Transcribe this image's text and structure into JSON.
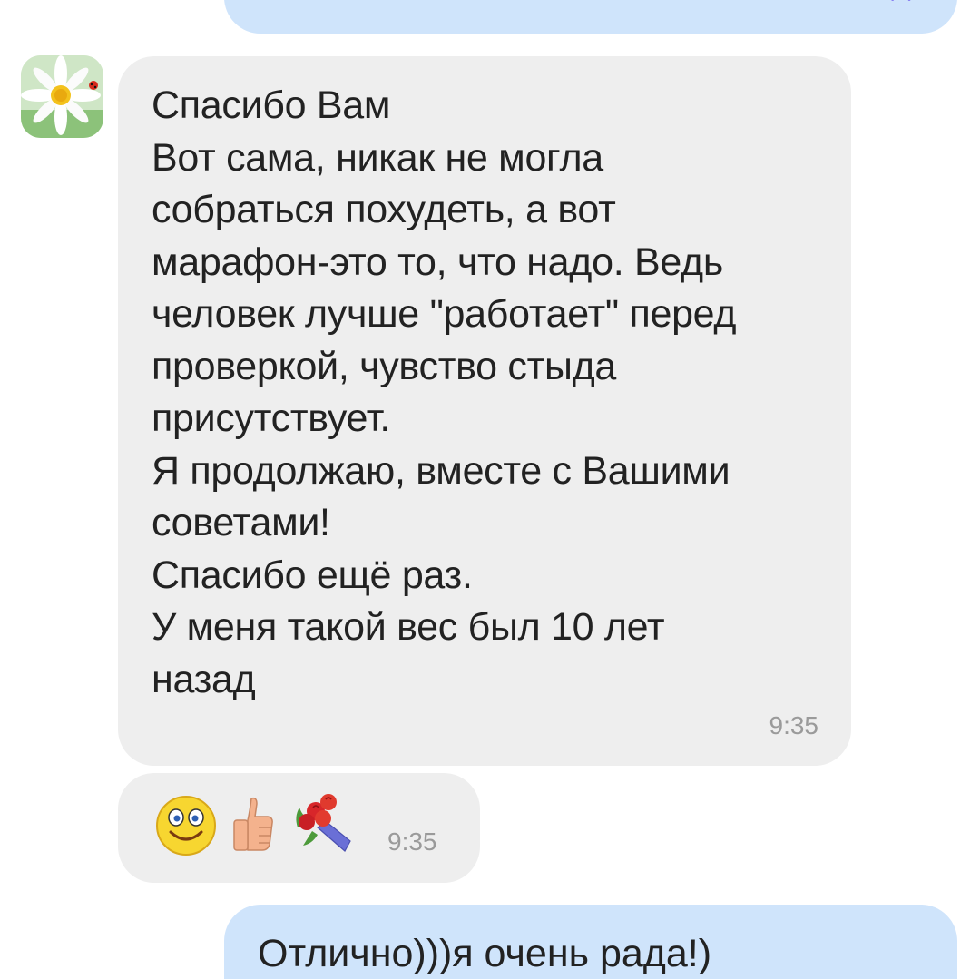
{
  "chat": {
    "messages": [
      {
        "direction": "incoming",
        "lines": [
          "Спасибо Вам",
          "Вот сама, никак не могла",
          "собраться похудеть, а вот",
          "марафон-это то, что надо. Ведь",
          "человек лучше \"работает\" перед",
          "проверкой, чувство стыда",
          "присутствует.",
          "Я продолжаю, вместе с Вашими",
          "советами!",
          "Спасибо ещё раз.",
          "У меня такой вес был 10 лет",
          "назад"
        ],
        "time": "9:35"
      },
      {
        "direction": "incoming",
        "emojis": [
          "smiling-face-emoji",
          "thumbs-up-emoji",
          "bouquet-emoji"
        ],
        "time": "9:35"
      },
      {
        "direction": "outgoing",
        "text": "Отлично)))я очень рада!)"
      }
    ],
    "top_outgoing": {
      "ticks_icon": "double-check-icon"
    },
    "sender_avatar_icon": "daisy-avatar-icon"
  },
  "colors": {
    "incoming_bubble": "#eeeeee",
    "outgoing_bubble": "#cfe4fb",
    "text": "#222222",
    "time": "#9a9a9a",
    "read_ticks": "#7a6df0"
  }
}
